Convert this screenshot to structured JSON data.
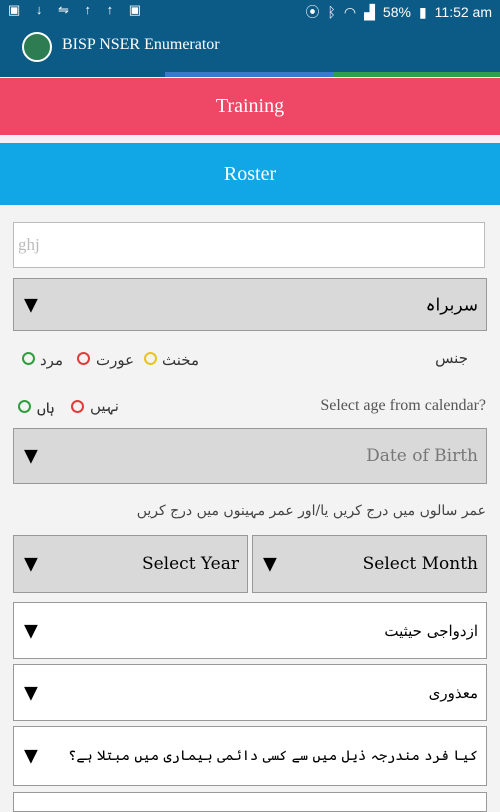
{
  "status_bar": {
    "left_icons": "▣ ↓ ⇋ ↑ ↑ ▣",
    "battery": "58%",
    "time": "11:52 am"
  },
  "app_bar": {
    "title": "BISP NSER Enumerator"
  },
  "buttons": {
    "training": "Training",
    "roster": "Roster"
  },
  "name_field": {
    "value": "ghj"
  },
  "relation_select": {
    "value": "سربراہ"
  },
  "gender": {
    "label": "جنس",
    "options": [
      {
        "label": "مرد",
        "color": "#2e9e3e"
      },
      {
        "label": "عورت",
        "color": "#e23b3b"
      },
      {
        "label": "مخنث",
        "color": "#e6c51c"
      }
    ]
  },
  "age_calendar": {
    "question": "Select age from calendar?",
    "options": [
      {
        "label": "نہیں",
        "color": "#e23b3b"
      },
      {
        "label": "ہاں",
        "color": "#2e9e3e"
      }
    ]
  },
  "dob_select": {
    "value": "Date of Birth"
  },
  "age_hint": "عمر سالوں میں درج کریں یا/اور عمر مہینوں میں درج کریں",
  "year_select": {
    "value": "Select Year"
  },
  "month_select": {
    "value": "Select Month"
  },
  "marital_select": {
    "value": "ازدواجی حیثیت"
  },
  "disability_select": {
    "value": "معذوری"
  },
  "disease_select": {
    "value": "کیا فرد مندرجہ ذیل میں سے کسی دائمی بیماری میں مبتلا ہے؟"
  },
  "colors": {
    "primary": "#0c5a86",
    "training": "#ee4866",
    "roster": "#11a7e6"
  }
}
